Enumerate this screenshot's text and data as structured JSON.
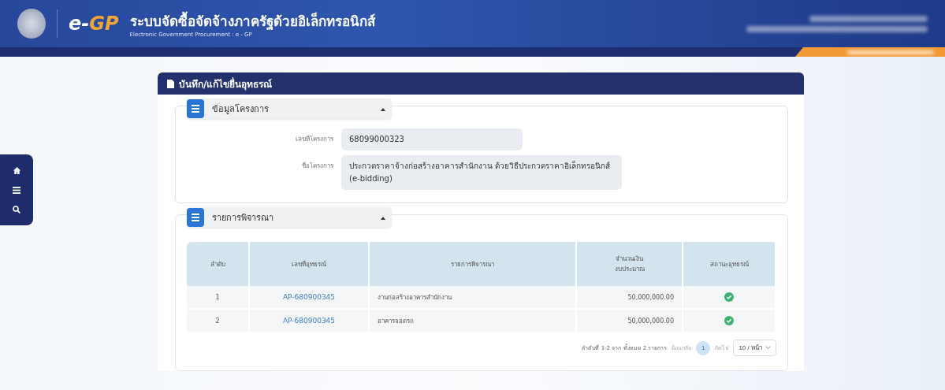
{
  "header": {
    "logo_e": "e-",
    "logo_gp": "GP",
    "title": "ระบบจัดซื้อจัดจ้างภาครัฐด้วยอิเล็กทรอนิกส์",
    "subtitle": "Electronic Government Procurement : e - GP"
  },
  "panel": {
    "title": "บันทึก/แก้ไขยื่นอุทธรณ์"
  },
  "project_section": {
    "title": "ข้อมูลโครงการ",
    "expanded": true,
    "fields": [
      {
        "label": "เลขที่โครงการ",
        "value": "68099000323",
        "kind": "input"
      },
      {
        "label": "ชื่อโครงการ",
        "value": "ประกวดราคาจ้างก่อสร้างอาคารสำนักงาน ด้วยวิธีประกวดราคาอิเล็กทรอนิกส์ (e-bidding)",
        "kind": "textarea"
      }
    ]
  },
  "items_section": {
    "title": "รายการพิจารณา",
    "expanded": true,
    "table": {
      "columns": [
        "ลำดับ",
        "เลขที่อุทธรณ์",
        "รายการพิจารณา",
        "จำนวนเงิน\nงบประมาณ",
        "สถานะอุทธรณ์"
      ],
      "rows": [
        {
          "no": "1",
          "appeal_no": "AP-680900345",
          "item": "งานก่อสร้างอาคารสำนักงาน",
          "amount": "50,000,000.00",
          "status_ok": true
        },
        {
          "no": "2",
          "appeal_no": "AP-680900345",
          "item": "อาคารจอดรถ",
          "amount": "50,000,000.00",
          "status_ok": true
        }
      ]
    },
    "pagination": {
      "summary": "ลำดับที่ 1-2 จาก ทั้งหมด 2 รายการ",
      "prev": "ย้อนกลับ",
      "pages": [
        {
          "label": "1",
          "selected": true
        }
      ],
      "next": "ถัดไป",
      "page_size": "10 / หน้า"
    }
  }
}
